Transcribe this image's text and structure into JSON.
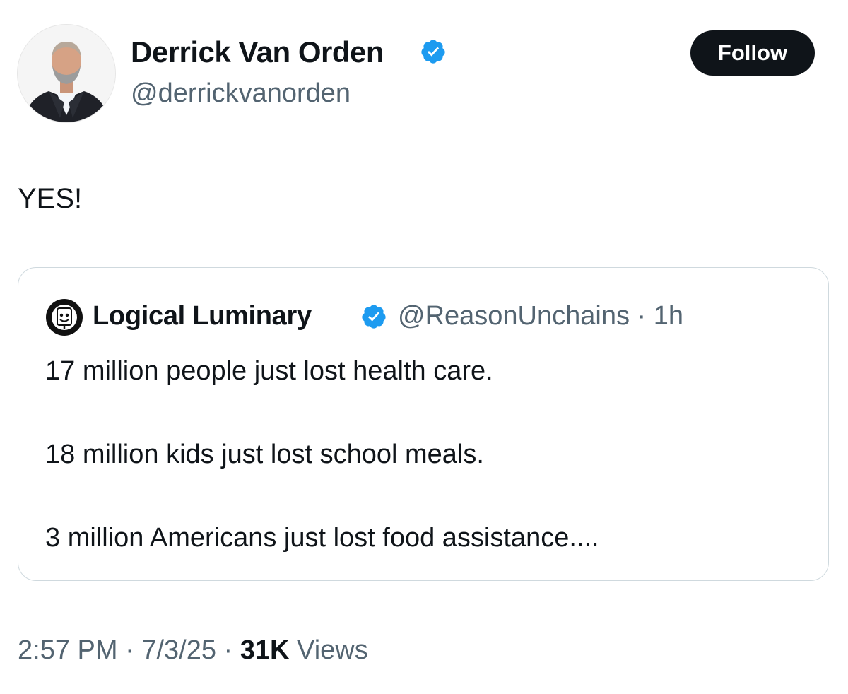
{
  "author": {
    "display_name": "Derrick Van Orden",
    "handle": "@derrickvanorden",
    "verified_icon": "verified-badge-icon"
  },
  "follow_button": {
    "label": "Follow"
  },
  "tweet": {
    "text": "YES!"
  },
  "quoted_tweet": {
    "author_name": "Logical Luminary",
    "handle_and_time": "@ReasonUnchains · 1h",
    "lines": [
      "17 million people just lost health care.",
      "18 million kids just lost school meals.",
      "3 million Americans just lost food assistance...."
    ]
  },
  "meta": {
    "time": "2:57 PM",
    "date": "7/3/25",
    "views_count": "31K",
    "views_label": "Views"
  },
  "colors": {
    "text_primary": "#0f1419",
    "text_secondary": "#536471",
    "verified_blue": "#1d9bf0",
    "border": "#cfd9de"
  }
}
